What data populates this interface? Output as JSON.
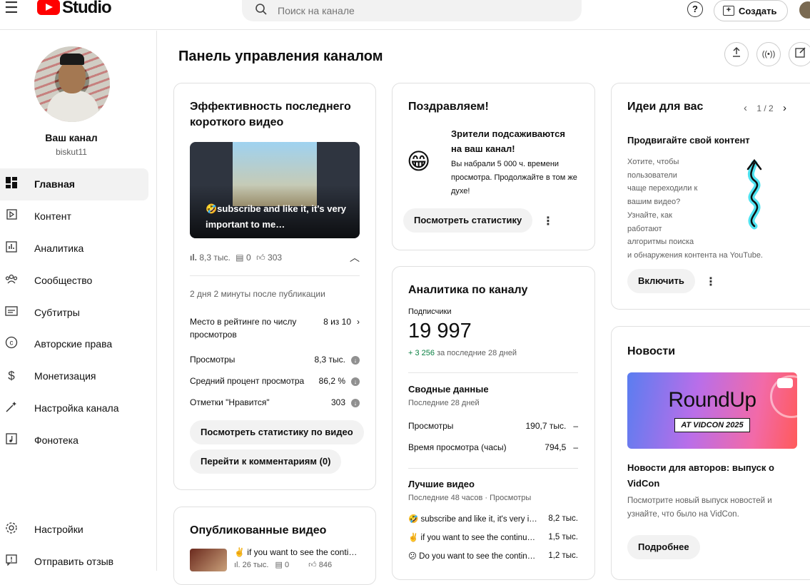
{
  "topbar": {
    "logo_text": "Studio",
    "search_placeholder": "Поиск на канале",
    "help_label": "?",
    "create_label": "Создать"
  },
  "sidebar": {
    "channel_name": "Ваш канал",
    "channel_handle": "biskut11",
    "items": [
      {
        "label": "Главная",
        "icon": "dashboard-icon"
      },
      {
        "label": "Контент",
        "icon": "content-icon"
      },
      {
        "label": "Аналитика",
        "icon": "analytics-icon"
      },
      {
        "label": "Сообщество",
        "icon": "community-icon"
      },
      {
        "label": "Субтитры",
        "icon": "subtitles-icon"
      },
      {
        "label": "Авторские права",
        "icon": "copyright-icon"
      },
      {
        "label": "Монетизация",
        "icon": "monetization-icon"
      },
      {
        "label": "Настройка канала",
        "icon": "customization-icon"
      },
      {
        "label": "Фонотека",
        "icon": "audio-library-icon"
      }
    ],
    "bottom_items": [
      {
        "label": "Настройки",
        "icon": "settings-icon"
      },
      {
        "label": "Отправить отзыв",
        "icon": "feedback-icon"
      }
    ]
  },
  "main": {
    "title": "Панель управления каналом"
  },
  "latest_short": {
    "title": "Эффективность последнего короткого видео",
    "thumb_caption": "🤣subscribe and like it, it's very important to me…",
    "views": "8,3 тыс.",
    "comments": "0",
    "likes": "303",
    "since": "2 дня 2 минуты после публикации",
    "rank_label": "Место в рейтинге по числу просмотров",
    "rank_value": "8 из 10",
    "stats": [
      {
        "label": "Просмотры",
        "value": "8,3 тыс."
      },
      {
        "label": "Средний процент просмотра",
        "value": "86,2 %"
      },
      {
        "label": "Отметки \"Нравится\"",
        "value": "303"
      }
    ],
    "btn_stats": "Посмотреть статистику по видео",
    "btn_comments": "Перейти к комментариям (0)"
  },
  "published": {
    "title": "Опубликованные видео",
    "item_title": "✌️ if you want to see the conti…",
    "item_views": "26 тыс.",
    "item_comments": "0",
    "item_likes": "846"
  },
  "congrats": {
    "title": "Поздравляем!",
    "emoji": "😁",
    "headline": "Зрители подсаживаются на ваш канал!",
    "text": "Вы набрали 5 000 ч. времени просмотра. Продолжайте в том же духе!",
    "button": "Посмотреть статистику"
  },
  "analytics": {
    "title": "Аналитика по каналу",
    "subs_label": "Подписчики",
    "subs_value": "19 997",
    "subs_delta": "+ 3 256",
    "subs_delta_suffix": "за последние 28 дней",
    "summary_title": "Сводные данные",
    "summary_period": "Последние 28 дней",
    "summary": [
      {
        "label": "Просмотры",
        "value": "190,7 тыс."
      },
      {
        "label": "Время просмотра (часы)",
        "value": "794,5"
      }
    ],
    "top_title": "Лучшие видео",
    "top_period": "Последние 48 часов · Просмотры",
    "top": [
      {
        "title": "🤣 subscribe and like it, it's very i…",
        "value": "8,2 тыс."
      },
      {
        "title": "✌️ if you want to see the continu…",
        "value": "1,5 тыс."
      },
      {
        "title": "😕 Do you want to see the contin…",
        "value": "1,2 тыс."
      }
    ]
  },
  "ideas": {
    "title": "Идеи для вас",
    "pager": "1 / 2",
    "subtitle": "Продвигайте свой контент",
    "text_lines": [
      "Хотите, чтобы",
      "пользователи",
      "чаще переходили к",
      "вашим видео?",
      "Узнайте, как",
      "работают",
      "алгоритмы поиска",
      "и обнаружения контента на YouTube."
    ],
    "button": "Включить"
  },
  "news": {
    "title": "Новости",
    "banner_main": "RoundUp",
    "banner_sub": "AT VIDCON 2025",
    "headline": "Новости для авторов: выпуск о VidCon",
    "text": "Посмотрите новый выпуск новостей и узнайте, что было на VidCon.",
    "button": "Подробнее"
  },
  "colors": {
    "brand_red": "#ff0000",
    "delta_green": "#0b8043",
    "highlight_cyan": "#4fe3f0"
  }
}
